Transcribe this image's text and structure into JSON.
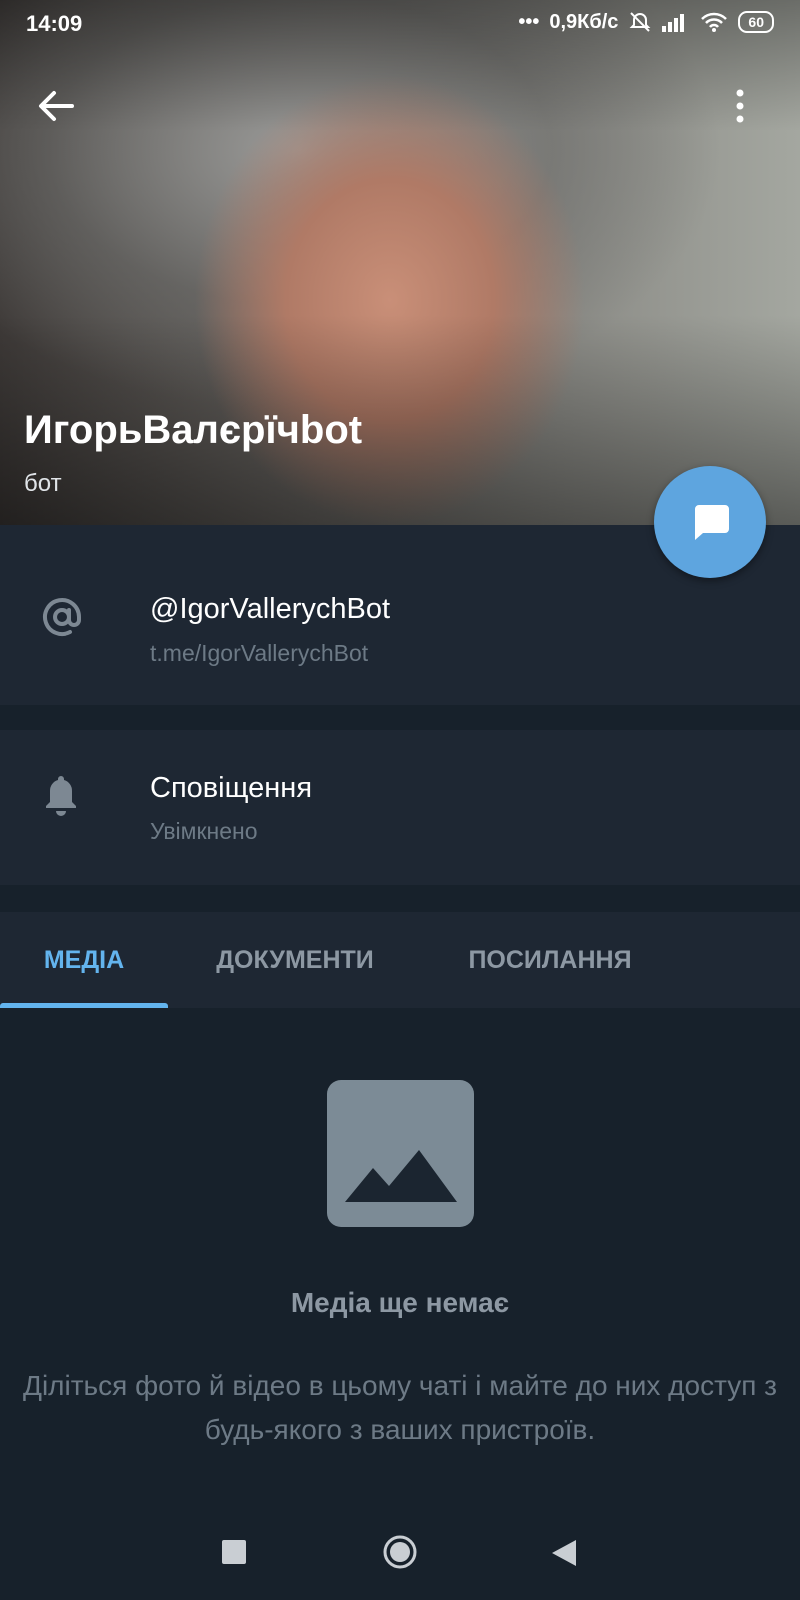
{
  "status_bar": {
    "time": "14:09",
    "network_speed": "0,9Кб/с",
    "battery": "60",
    "icons": [
      "signal-dots-icon",
      "alarm-off-icon",
      "cellular-signal-icon",
      "wifi-icon",
      "battery-icon"
    ]
  },
  "profile": {
    "name": "ИгорьВалєрїчbot",
    "subtitle": "бот"
  },
  "info_rows": [
    {
      "icon": "at-sign-icon",
      "title": "@IgorVallerychBot",
      "subtitle": "t.me/IgorVallerychBot"
    },
    {
      "icon": "bell-icon",
      "title": "Сповіщення",
      "subtitle": "Увімкнено"
    }
  ],
  "tabs": [
    {
      "label": "МЕДІА",
      "active": true
    },
    {
      "label": "ДОКУМЕНТИ",
      "active": false
    },
    {
      "label": "ПОСИЛАННЯ",
      "active": false
    }
  ],
  "empty_state": {
    "icon": "image-placeholder-icon",
    "title": "Медіа ще немає",
    "text": "Діліться фото й відео в цьому чаті і майте до них доступ з будь-якого з ваших пристроїв."
  },
  "colors": {
    "background": "#17212b",
    "section": "#1e2733",
    "accent": "#63b4ee",
    "fab": "#5ea5df",
    "muted": "#6d7a86"
  },
  "navigation": [
    "recent-apps-icon",
    "home-icon",
    "back-nav-icon"
  ]
}
